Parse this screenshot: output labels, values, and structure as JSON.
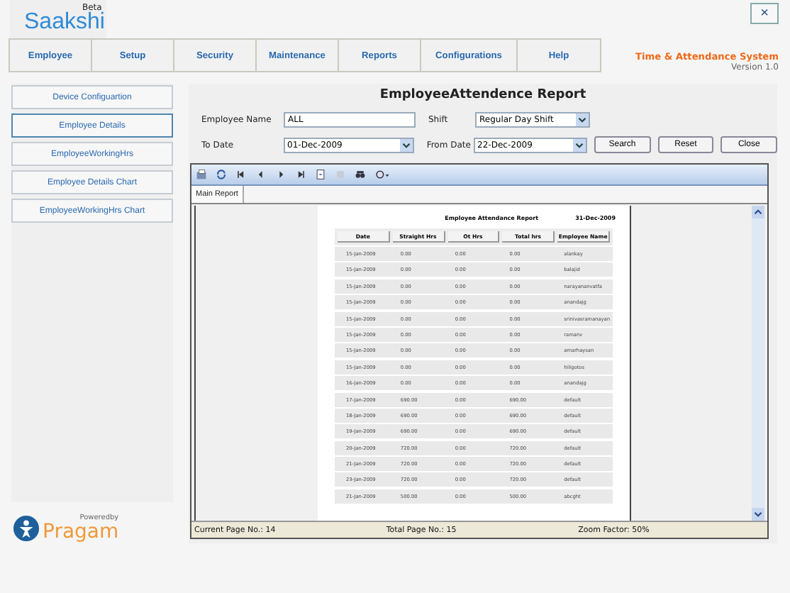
{
  "header": {
    "app_name": "Saakshi",
    "badge": "Beta",
    "system_title": "Time & Attendance System",
    "version": "Version 1.0",
    "close": "×"
  },
  "menu": [
    "Employee",
    "Setup",
    "Security",
    "Maintenance",
    "Reports",
    "Configurations",
    "Help"
  ],
  "sidebar": {
    "items": [
      {
        "label": "Device Configuartion",
        "selected": false
      },
      {
        "label": "Employee Details",
        "selected": true
      },
      {
        "label": "EmployeeWorkingHrs",
        "selected": false
      },
      {
        "label": "Employee Details Chart",
        "selected": false
      },
      {
        "label": "EmployeeWorkingHrs Chart",
        "selected": false
      }
    ]
  },
  "form": {
    "title": "EmployeeAttendence Report",
    "employee_name": {
      "label": "Employee Name",
      "value": "ALL"
    },
    "shift": {
      "label": "Shift",
      "value": "Regular Day Shift"
    },
    "to_date": {
      "label": "To Date",
      "value": "01-Dec-2009"
    },
    "from_date": {
      "label": "From Date",
      "value": "22-Dec-2009"
    },
    "buttons": [
      "Search",
      "Reset",
      "Close"
    ]
  },
  "viewer": {
    "tabs": [
      {
        "label": "Main Report",
        "selected": true
      }
    ],
    "report": {
      "title": "Employee Attendance Report",
      "date": "31-Dec-2009",
      "columns": [
        "Date",
        "Straight Hrs",
        "Ot Hrs",
        "Total hrs",
        "Employee Name"
      ],
      "rows": [
        [
          "15-Jan-2009",
          "0.00",
          "0.00",
          "0.00",
          "alankay"
        ],
        [
          "15-Jan-2009",
          "0.00",
          "0.00",
          "0.00",
          "balajid"
        ],
        [
          "15-Jan-2009",
          "0.00",
          "0.00",
          "0.00",
          "narayananvatfa"
        ],
        [
          "15-Jan-2009",
          "0.00",
          "0.00",
          "0.00",
          "anandajg"
        ],
        [
          "15-Jan-2009",
          "0.00",
          "0.00",
          "0.00",
          "srinivasramanayan"
        ],
        [
          "15-Jan-2009",
          "0.00",
          "0.00",
          "0.00",
          "ramanv"
        ],
        [
          "15-Jan-2009",
          "0.00",
          "0.00",
          "0.00",
          "amarhaysan"
        ],
        [
          "15-Jan-2009",
          "0.00",
          "0.00",
          "0.00",
          "hiligotos"
        ],
        [
          "16-Jan-2009",
          "0.00",
          "0.00",
          "0.00",
          "anandajg"
        ],
        [
          "17-Jan-2009",
          "690.00",
          "0.00",
          "690.00",
          "default"
        ],
        [
          "18-Jan-2009",
          "690.00",
          "0.00",
          "690.00",
          "default"
        ],
        [
          "19-Jan-2009",
          "690.00",
          "0.00",
          "690.00",
          "default"
        ],
        [
          "20-Jan-2009",
          "720.00",
          "0.00",
          "720.00",
          "default"
        ],
        [
          "21-Jan-2009",
          "720.00",
          "0.00",
          "720.00",
          "default"
        ],
        [
          "23-Jan-2009",
          "720.00",
          "0.00",
          "720.00",
          "default"
        ],
        [
          "21-Jan-2009",
          "500.00",
          "0.00",
          "500.00",
          "abcght"
        ]
      ]
    },
    "status": [
      "Current Page No.: 14",
      "Total Page No.: 15",
      "Zoom Factor: 50%"
    ]
  },
  "footer": {
    "powered_by": "Poweredby",
    "brand": "Pragam"
  }
}
